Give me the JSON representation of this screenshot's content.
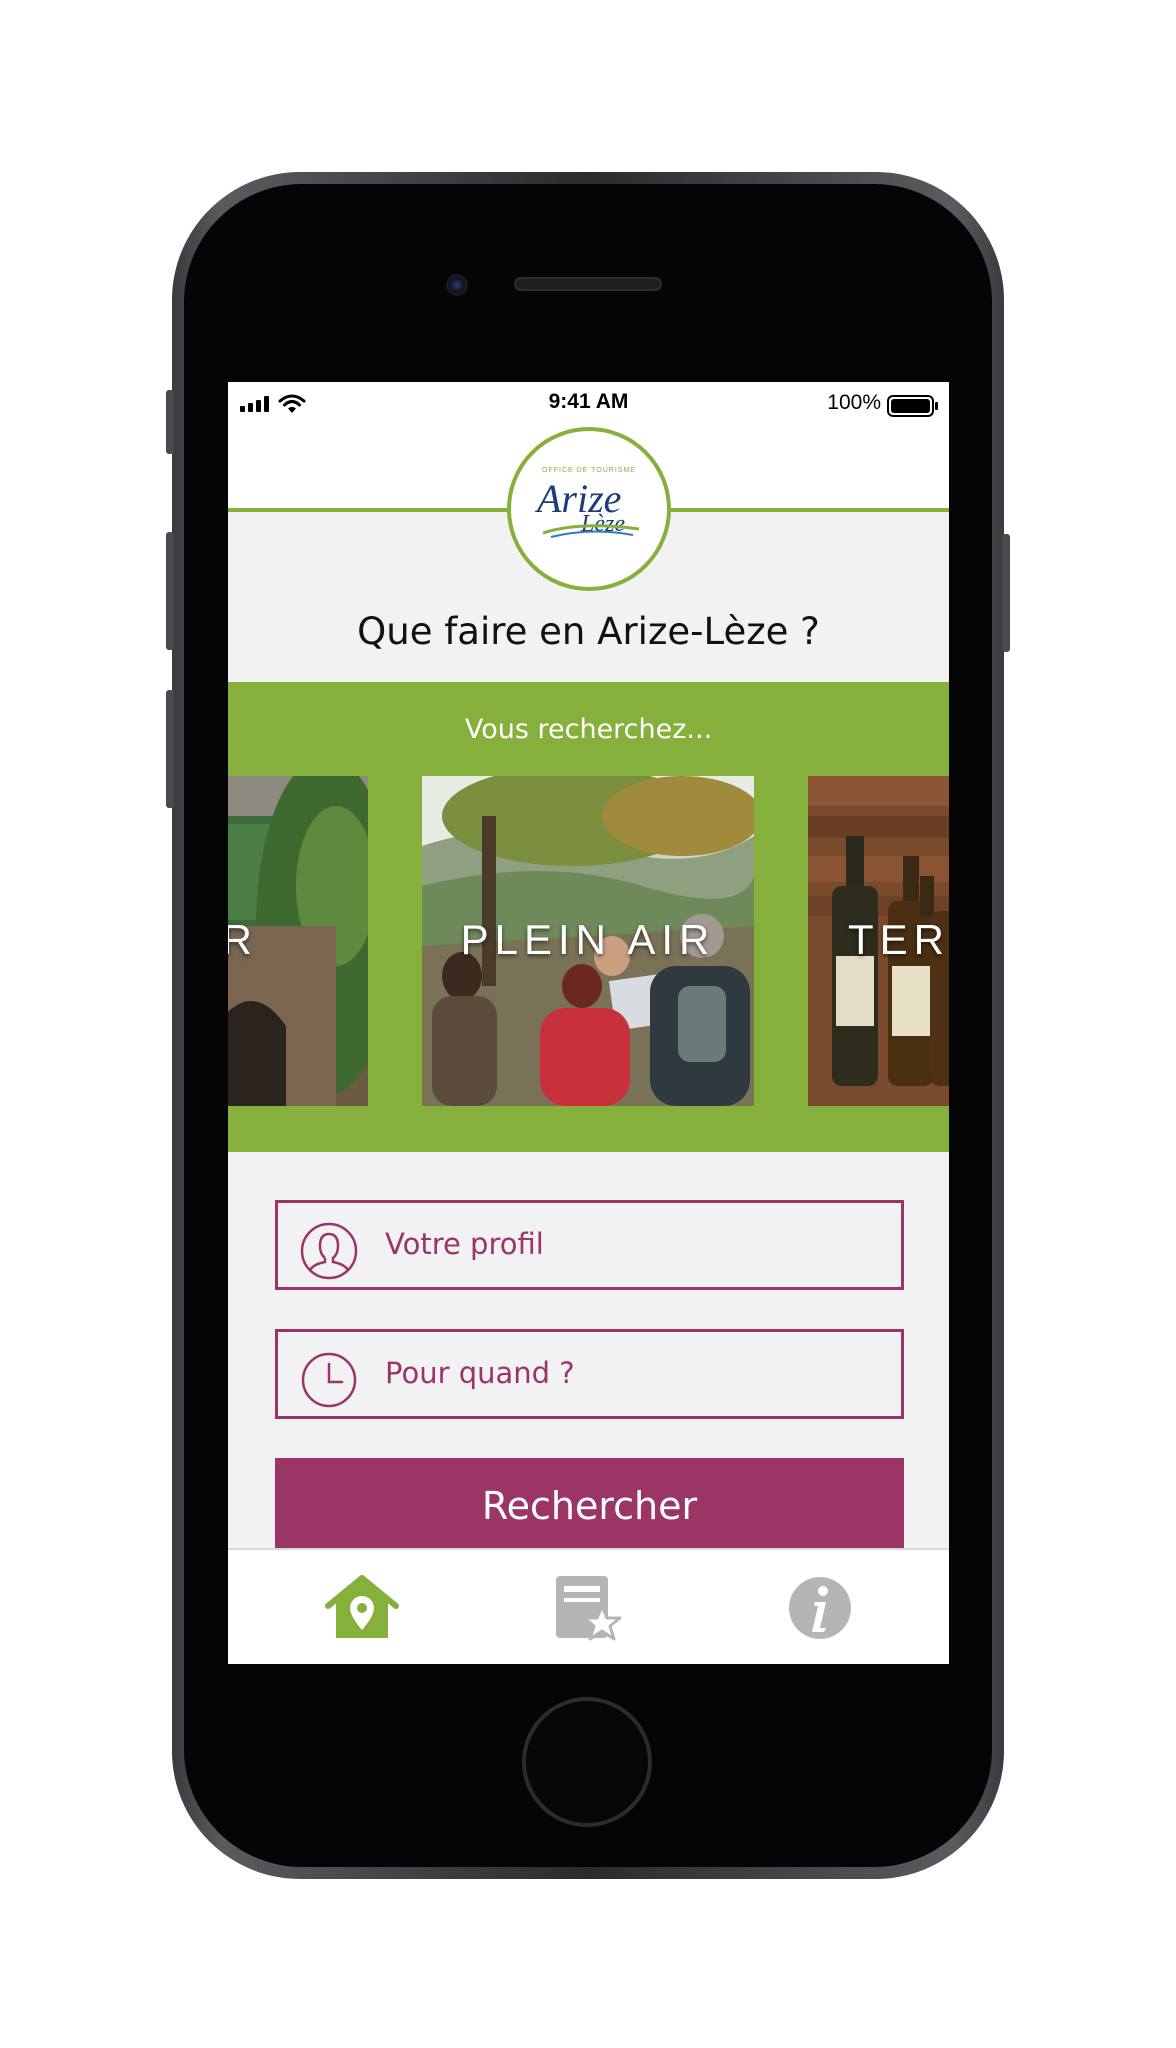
{
  "status_bar": {
    "time": "9:41 AM",
    "battery": "100%"
  },
  "logo": {
    "small_text": "OFFICE DE TOURISME",
    "main_text": "Arize",
    "sub_text": "Lèze"
  },
  "title": "Que faire en Arize-Lèze ?",
  "carousel": {
    "subtitle": "Vous recherchez...",
    "cards": [
      {
        "label": "VISITER",
        "visible_label": "TER"
      },
      {
        "label": "PLEIN AIR",
        "visible_label": "PLEIN AIR"
      },
      {
        "label": "TERROIR",
        "visible_label": "TER"
      }
    ]
  },
  "form": {
    "profile_label": "Votre profil",
    "when_label": "Pour quand ?",
    "search_label": "Rechercher"
  },
  "tab_bar": {
    "tabs": [
      {
        "icon": "home-location-icon",
        "active": true
      },
      {
        "icon": "favorites-icon",
        "active": false
      },
      {
        "icon": "info-icon",
        "active": false
      }
    ]
  },
  "colors": {
    "accent_green": "#86b03c",
    "accent_plum": "#9a3566",
    "logo_blue": "#1f3c7a",
    "inactive_icon": "#b5b5b5"
  }
}
